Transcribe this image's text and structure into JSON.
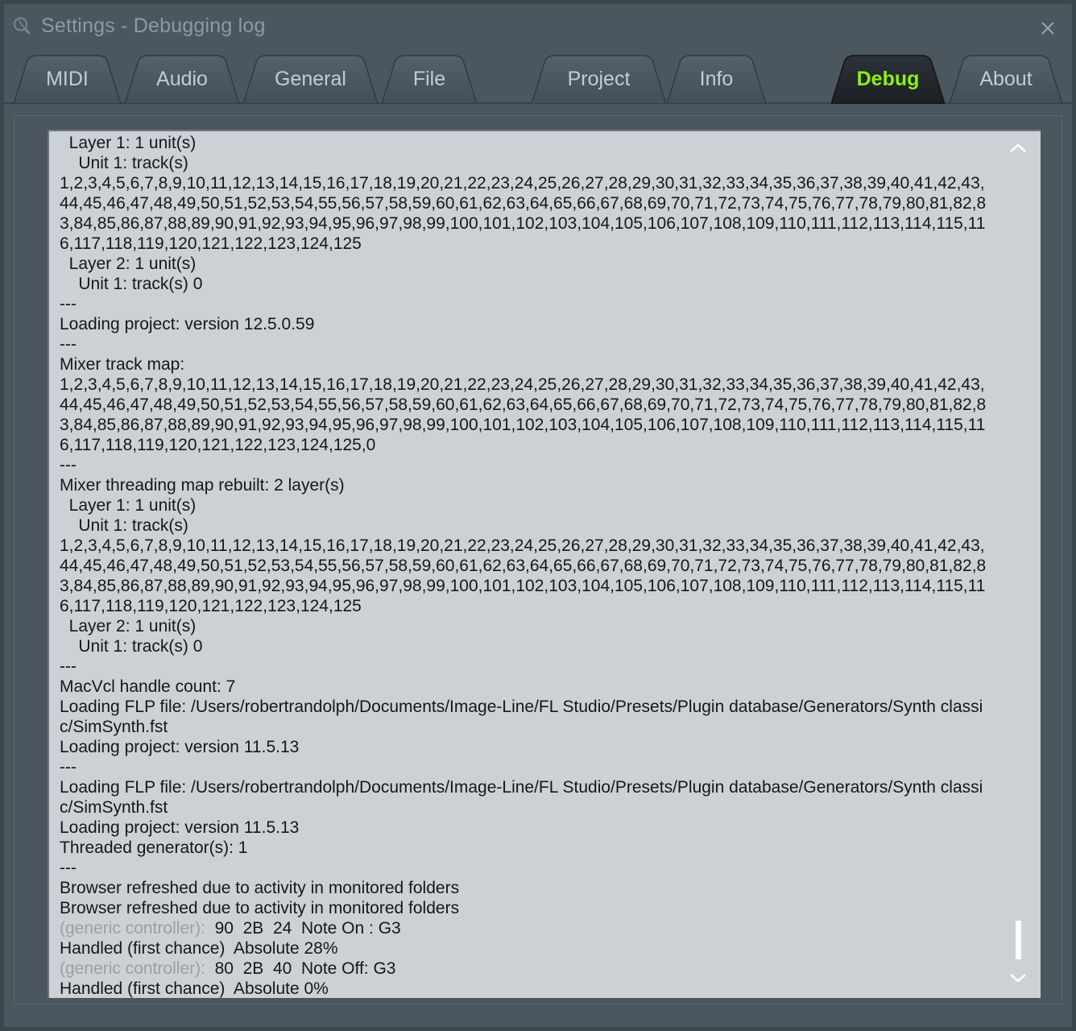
{
  "window": {
    "title": "Settings - Debugging log",
    "icon": "search-icon",
    "close_label": "close-icon",
    "accent_green": "#8fef10",
    "chrome_color": "#4b565e",
    "log_background": "#ccd1d5"
  },
  "tabs": [
    {
      "label": "MIDI",
      "active": false
    },
    {
      "label": "Audio",
      "active": false
    },
    {
      "label": "General",
      "active": false
    },
    {
      "label": "File",
      "active": false
    },
    {
      "label": "Project",
      "active": false
    },
    {
      "label": "Info",
      "active": false
    },
    {
      "label": "Debug",
      "active": true
    },
    {
      "label": "About",
      "active": false
    }
  ],
  "log": {
    "track_list_a": "1,2,3,4,5,6,7,8,9,10,11,12,13,14,15,16,17,18,19,20,21,22,23,24,25,26,27,28,29,30,31,32,33,34,35,36,37,38,39,40,41,42,43,44,45,46,47,48,49,50,51,52,53,54,55,56,57,58,59,60,61,62,63,64,65,66,67,68,69,70,71,72,73,74,75,76,77,78,79,80,81,82,83,84,85,86,87,88,89,90,91,92,93,94,95,96,97,98,99,100,101,102,103,104,105,106,107,108,109,110,111,112,113,114,115,116,117,118,119,120,121,122,123,124,125",
    "track_list_b": "1,2,3,4,5,6,7,8,9,10,11,12,13,14,15,16,17,18,19,20,21,22,23,24,25,26,27,28,29,30,31,32,33,34,35,36,37,38,39,40,41,42,43,44,45,46,47,48,49,50,51,52,53,54,55,56,57,58,59,60,61,62,63,64,65,66,67,68,69,70,71,72,73,74,75,76,77,78,79,80,81,82,83,84,85,86,87,88,89,90,91,92,93,94,95,96,97,98,99,100,101,102,103,104,105,106,107,108,109,110,111,112,113,114,115,116,117,118,119,120,121,122,123,124,125,0",
    "lines": [
      "  Layer 1: 1 unit(s)",
      "    Unit 1: track(s)",
      "__TRACKS_A__",
      "  Layer 2: 1 unit(s)",
      "    Unit 1: track(s) 0",
      "---",
      "Loading project: version 12.5.0.59",
      "---",
      "Mixer track map:",
      "__TRACKS_B__",
      "---",
      "Mixer threading map rebuilt: 2 layer(s)",
      "  Layer 1: 1 unit(s)",
      "    Unit 1: track(s)",
      "__TRACKS_A__",
      "  Layer 2: 1 unit(s)",
      "    Unit 1: track(s) 0",
      "---",
      "MacVcl handle count: 7",
      "Loading FLP file: /Users/robertrandolph/Documents/Image-Line/FL Studio/Presets/Plugin database/Generators/Synth classic/SimSynth.fst",
      "Loading project: version 11.5.13",
      "---",
      "Loading FLP file: /Users/robertrandolph/Documents/Image-Line/FL Studio/Presets/Plugin database/Generators/Synth classic/SimSynth.fst",
      "Loading project: version 11.5.13",
      "Threaded generator(s): 1",
      "---",
      "Browser refreshed due to activity in monitored folders",
      "Browser refreshed due to activity in monitored folders",
      "__MIDI1__",
      "Handled (first chance)  Absolute 28%",
      "__MIDI2__",
      "Handled (first chance)  Absolute 0%"
    ],
    "midi_events": [
      {
        "source": "(generic controller): ",
        "data": " 90  2B  24  Note On : G3"
      },
      {
        "source": "(generic controller): ",
        "data": " 80  2B  40  Note Off: G3"
      }
    ]
  },
  "scrollbar": {
    "up_arrow": "chevron-up-icon",
    "down_arrow": "chevron-down-icon",
    "thumb": "scroll-thumb"
  }
}
